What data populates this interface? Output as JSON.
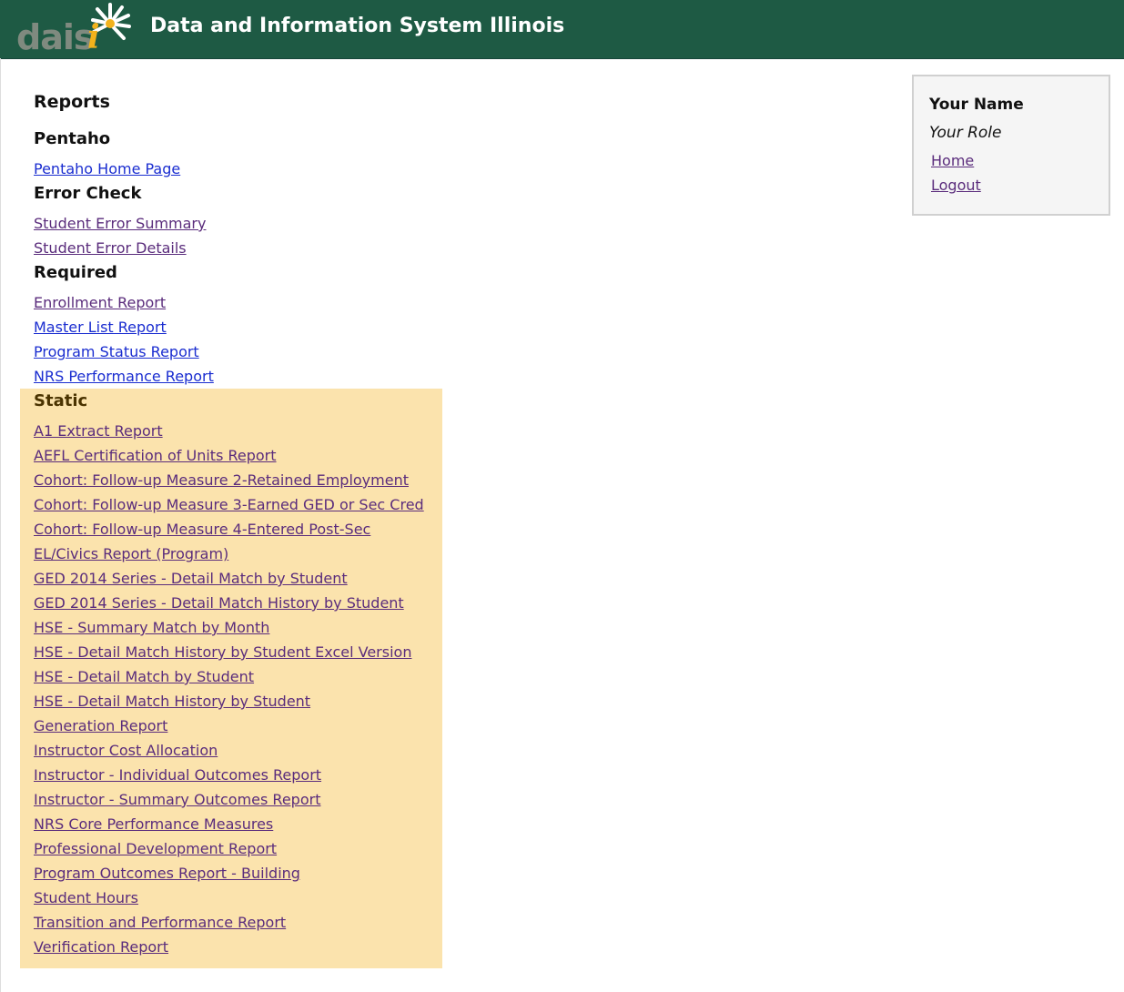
{
  "header": {
    "logo_text": "dais",
    "logo_i": "i",
    "title": "Data and Information System Illinois",
    "colors": {
      "background": "#1e5a44",
      "logo_gray": "#7f8a7f",
      "logo_yellow": "#f2b21c"
    }
  },
  "page": {
    "title": "Reports"
  },
  "sections": {
    "pentaho": {
      "title": "Pentaho",
      "links": [
        "Pentaho Home Page"
      ]
    },
    "error_check": {
      "title": "Error Check",
      "links": [
        "Student Error Summary",
        "Student Error Details"
      ]
    },
    "required": {
      "title": "Required",
      "links": [
        "Enrollment Report",
        "Master List Report",
        "Program Status Report",
        "NRS Performance Report"
      ]
    },
    "static": {
      "title": "Static",
      "highlight_color": "#fbe3ad",
      "links": [
        "A1 Extract Report",
        "AEFL Certification of Units Report",
        "Cohort: Follow-up Measure 2-Retained Employment",
        "Cohort: Follow-up Measure 3-Earned GED or Sec Cred",
        "Cohort: Follow-up Measure 4-Entered Post-Sec",
        "EL/Civics Report (Program)",
        "GED 2014 Series - Detail Match by Student",
        "GED 2014 Series - Detail Match History by Student",
        "HSE - Summary Match by Month",
        "HSE - Detail Match History by Student Excel Version",
        "HSE - Detail Match by Student",
        "HSE - Detail Match History by Student",
        "Generation Report",
        "Instructor Cost Allocation",
        "Instructor - Individual Outcomes Report",
        "Instructor - Summary Outcomes Report",
        "NRS Core Performance Measures",
        "Professional Development Report",
        "Program Outcomes Report - Building",
        "Student Hours",
        "Transition and Performance Report",
        "Verification Report"
      ]
    }
  },
  "user_panel": {
    "name": "Your Name",
    "role": "Your Role",
    "home_link": "Home",
    "logout_link": "Logout"
  },
  "link_colors": {
    "visited": "#5a2c7c",
    "unvisited": "#1a2dd0"
  },
  "icons": {
    "logo_flower": "daisy-flower-icon"
  }
}
